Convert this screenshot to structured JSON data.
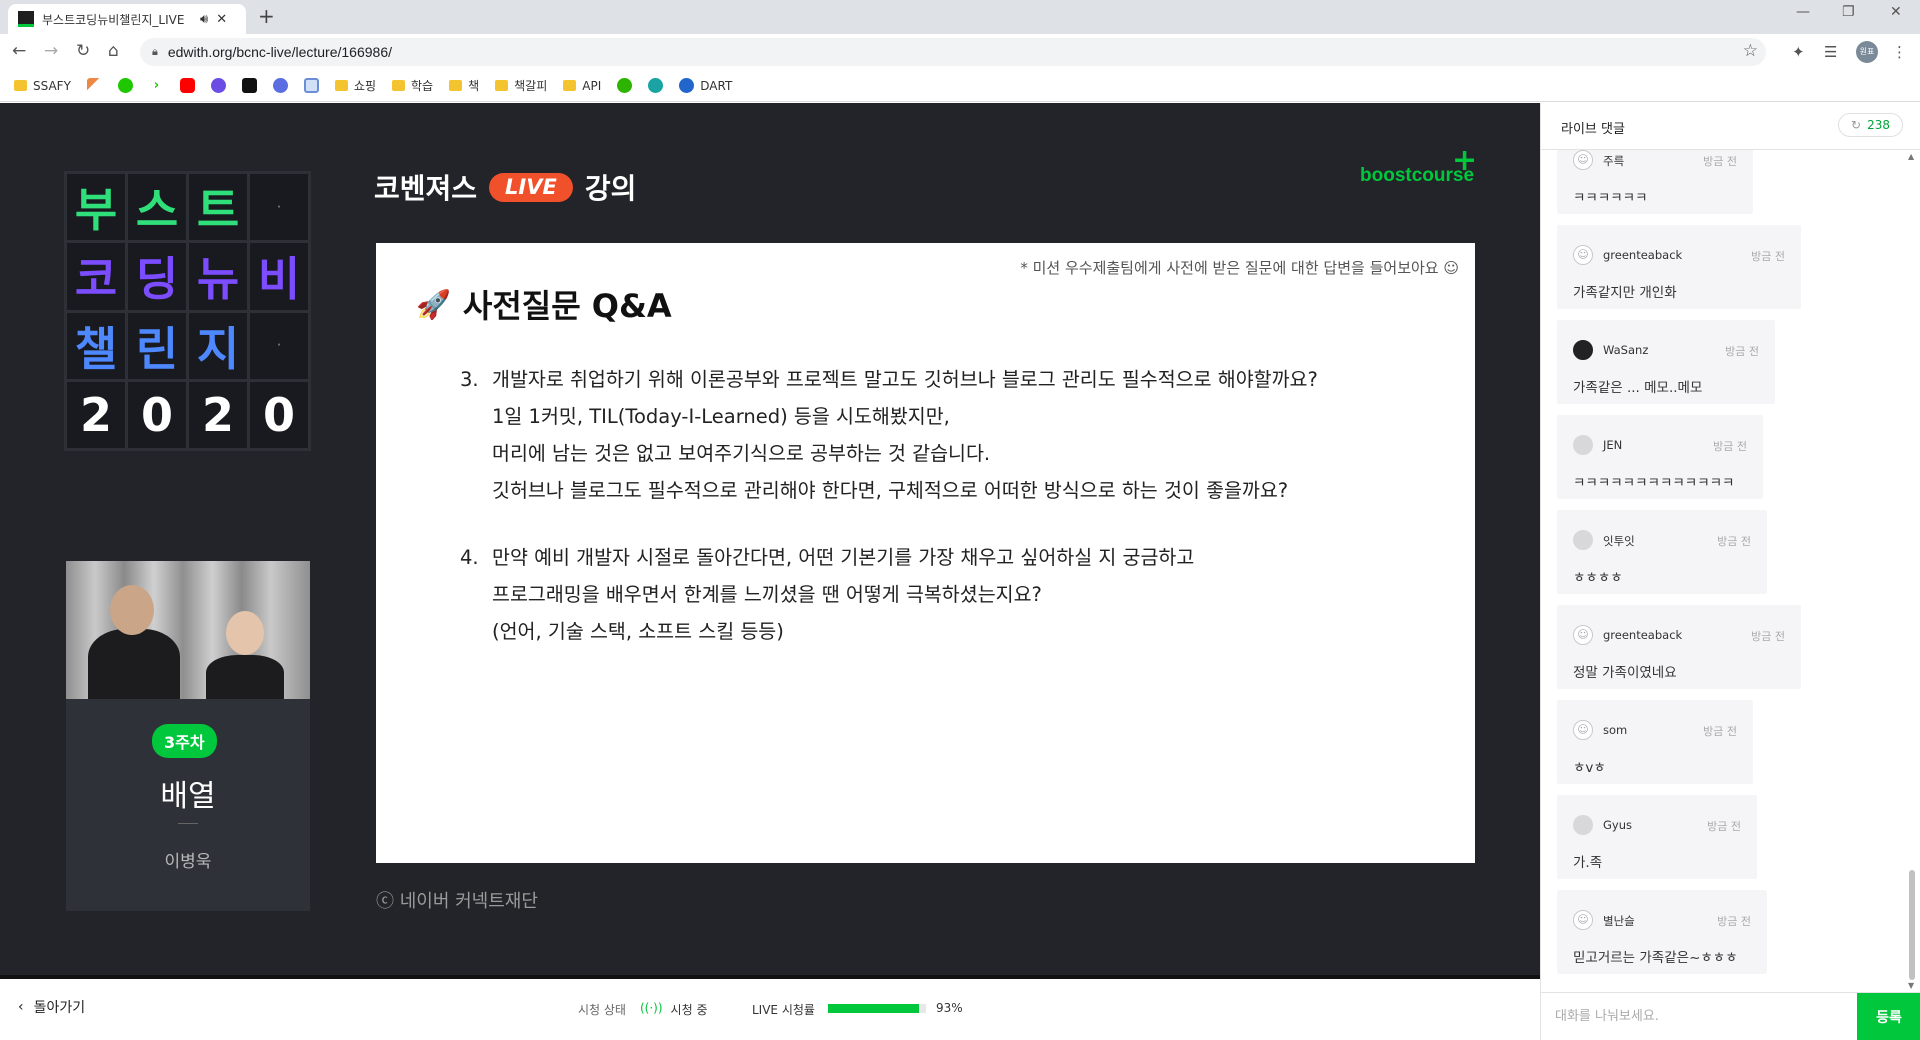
{
  "browser": {
    "tab_title": "부스트코딩뉴비챌린지_LIVE",
    "url": "edwith.org/bcnc-live/lecture/166986/",
    "profile_label": "원표",
    "bookmarks": [
      "SSAFY",
      "쇼핑",
      "학습",
      "책",
      "책갈피",
      "API",
      "DART"
    ]
  },
  "stage": {
    "logo_rows": [
      [
        "부",
        "스",
        "트",
        "·"
      ],
      [
        "코",
        "딩",
        "뉴",
        "비"
      ],
      [
        "챌",
        "린",
        "지",
        "·"
      ],
      [
        "2",
        "0",
        "2",
        "0"
      ]
    ],
    "logo_colors": {
      "green": "#2fe07a",
      "purple": "#7b4dff",
      "blue": "#4e88ff",
      "white": "#ffffff"
    },
    "week_badge": "3주차",
    "lesson_title": "배열",
    "instructor": "이병욱",
    "brand_title": "코벤져스",
    "live_label": "LIVE",
    "lecture_label": "강의",
    "boostcourse": "boostcourse",
    "copyright": "ⓒ 네이버 커넥트재단"
  },
  "slide": {
    "note": "* 미션 우수제출팀에게 사전에 받은 질문에 대한 답변을 들어보아요 ☺",
    "title": "사전질문 Q&A",
    "questions": [
      {
        "number": "3.",
        "lines": [
          "개발자로 취업하기 위해 이론공부와 프로젝트 말고도 깃허브나 블로그 관리도 필수적으로 해야할까요?",
          "1일 1커밋, TIL(Today-I-Learned) 등을 시도해봤지만,",
          "머리에 남는 것은 없고 보여주기식으로 공부하는 것 같습니다.",
          "깃허브나 블로그도 필수적으로 관리해야 한다면, 구체적으로 어떠한 방식으로 하는 것이 좋을까요?"
        ]
      },
      {
        "number": "4.",
        "lines": [
          "만약 예비 개발자 시절로 돌아간다면, 어떤 기본기를 가장 채우고 싶어하실 지 궁금하고",
          "프로그래밍을 배우면서 한계를 느끼셨을 땐 어떻게 극복하셨는지요?",
          "(언어, 기술 스택, 소프트 스킬 등등)"
        ]
      }
    ]
  },
  "bottom": {
    "back_label": "돌아가기",
    "watch_status_label": "시청 상태",
    "watching_label": "시청 중",
    "live_rate_label": "LIVE 시청률",
    "live_rate": "93%",
    "live_rate_value": 0.93
  },
  "chat": {
    "title": "라이브 댓글",
    "count": "238",
    "input_placeholder": "대화를 나눠보세요.",
    "send_label": "등록",
    "comments": [
      {
        "name": "주륵",
        "time": "방금 전",
        "text": "ㅋㅋㅋㅋㅋㅋ"
      },
      {
        "name": "greenteaback",
        "time": "방금 전",
        "text": "가족같지만 개인화"
      },
      {
        "name": "WaSanz",
        "time": "방금 전",
        "text": "가족같은 ... 메모..메모"
      },
      {
        "name": "JEN",
        "time": "방금 전",
        "text": "ㅋㅋㅋㅋㅋㅋㅋㅋㅋㅋㅋㅋㅋ"
      },
      {
        "name": "잇투잇",
        "time": "방금 전",
        "text": "ㅎㅎㅎㅎ"
      },
      {
        "name": "greenteaback",
        "time": "방금 전",
        "text": "정말 가족이였네요"
      },
      {
        "name": "som",
        "time": "방금 전",
        "text": "ㅎvㅎ"
      },
      {
        "name": "Gyus",
        "time": "방금 전",
        "text": "가.족"
      },
      {
        "name": "별난슬",
        "time": "방금 전",
        "text": "믿고거르는 가족같은~ㅎㅎㅎ"
      }
    ]
  }
}
